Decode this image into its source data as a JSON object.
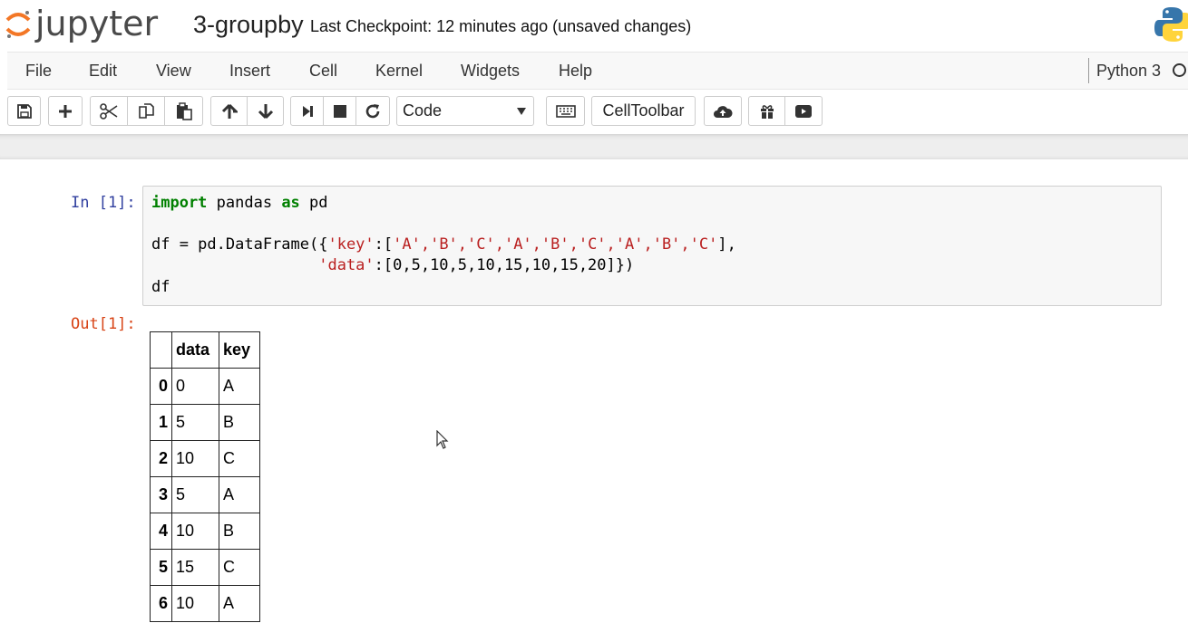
{
  "header": {
    "logo_text": "jupyter",
    "notebook_title": "3-groupby",
    "checkpoint": "Last Checkpoint: 12 minutes ago (unsaved changes)"
  },
  "menu": {
    "items": [
      "File",
      "Edit",
      "View",
      "Insert",
      "Cell",
      "Kernel",
      "Widgets",
      "Help"
    ],
    "kernel_name": "Python 3"
  },
  "toolbar": {
    "buttons": [
      "save-icon",
      "plus-icon",
      "scissors-icon",
      "copy-icon",
      "paste-icon",
      "arrow-up-icon",
      "arrow-down-icon",
      "step-forward-icon",
      "stop-icon",
      "restart-icon",
      "keyboard-icon",
      "cloud-upload-icon",
      "gift-icon",
      "play-video-icon"
    ],
    "cell_type": "Code",
    "celltoolbar_label": "CellToolbar"
  },
  "cell": {
    "prompt_in": "In [1]:",
    "prompt_out": "Out[1]:",
    "code": {
      "line1_kw1": "import",
      "line1_mid": " pandas ",
      "line1_kw2": "as",
      "line1_end": " pd",
      "line2_a": "df = pd.DataFrame({",
      "line2_str": "'key'",
      "line2_b": ":[",
      "line2_vals": "'A','B','C','A','B','C','A','B','C'",
      "line2_c": "],",
      "line3_str": "'data'",
      "line3_b": ":[0,5,10,5,10,15,10,15,20]})",
      "line4": "df"
    }
  },
  "dataframe": {
    "columns": [
      "",
      "data",
      "key"
    ],
    "rows": [
      {
        "index": "0",
        "data": "0",
        "key": "A"
      },
      {
        "index": "1",
        "data": "5",
        "key": "B"
      },
      {
        "index": "2",
        "data": "10",
        "key": "C"
      },
      {
        "index": "3",
        "data": "5",
        "key": "A"
      },
      {
        "index": "4",
        "data": "10",
        "key": "B"
      },
      {
        "index": "5",
        "data": "15",
        "key": "C"
      },
      {
        "index": "6",
        "data": "10",
        "key": "A"
      }
    ]
  },
  "colors": {
    "logo_orange": "#f37726",
    "prompt_in": "#303f9f",
    "prompt_out": "#d84315",
    "keyword": "#008000",
    "string": "#ba2121"
  }
}
